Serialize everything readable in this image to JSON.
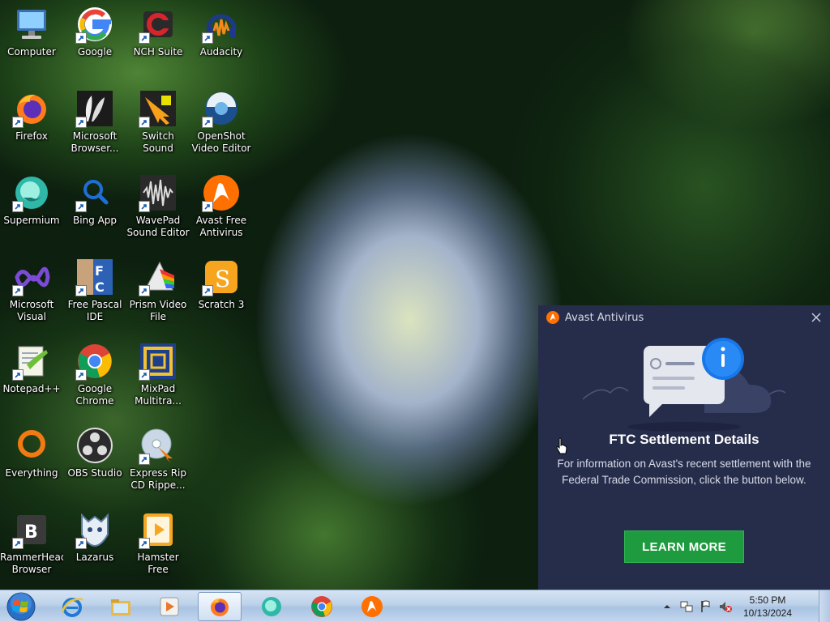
{
  "desktop": {
    "icons": [
      {
        "label": "Computer",
        "icon": "computer-icon"
      },
      {
        "label": "Google",
        "icon": "google-icon"
      },
      {
        "label": "NCH Suite",
        "icon": "nch-suite-icon"
      },
      {
        "label": "Audacity",
        "icon": "audacity-icon"
      },
      {
        "label": "Firefox",
        "icon": "firefox-icon"
      },
      {
        "label": "Microsoft\nBrowser...",
        "icon": "microsoft-browser-icon"
      },
      {
        "label": "Switch Sound\nFile Converter",
        "icon": "switch-sound-icon"
      },
      {
        "label": "OpenShot\nVideo Editor",
        "icon": "openshot-icon"
      },
      {
        "label": "Supermium",
        "icon": "supermium-icon"
      },
      {
        "label": "Bing App",
        "icon": "bing-app-icon"
      },
      {
        "label": "WavePad\nSound Editor",
        "icon": "wavepad-icon"
      },
      {
        "label": "Avast Free\nAntivirus",
        "icon": "avast-icon"
      },
      {
        "label": "Microsoft\nVisual Stud...",
        "icon": "visual-studio-icon"
      },
      {
        "label": "Free Pascal\nIDE",
        "icon": "free-pascal-icon"
      },
      {
        "label": "Prism Video\nFile Converter",
        "icon": "prism-video-icon"
      },
      {
        "label": "Scratch 3",
        "icon": "scratch-icon"
      },
      {
        "label": "Notepad++",
        "icon": "notepadpp-icon"
      },
      {
        "label": "Google\nChrome",
        "icon": "chrome-icon"
      },
      {
        "label": "MixPad\nMultitra...",
        "icon": "mixpad-icon"
      },
      {
        "label": "Everything",
        "icon": "everything-icon"
      },
      {
        "label": "OBS Studio",
        "icon": "obs-studio-icon"
      },
      {
        "label": "Express Rip\nCD Rippe...",
        "icon": "express-rip-icon"
      },
      {
        "label": "RammerHead\nBrowser",
        "icon": "rammerhead-icon"
      },
      {
        "label": "Lazarus",
        "icon": "lazarus-icon"
      },
      {
        "label": "Hamster Free\nVideo Conv...",
        "icon": "hamster-video-icon"
      }
    ]
  },
  "popup": {
    "app_name": "Avast Antivirus",
    "heading": "FTC Settlement Details",
    "body": "For information on Avast's recent settlement with the Federal Trade Commission, click the button below.",
    "button_label": "LEARN MORE",
    "accent": "#1e9b3f",
    "background": "#262d4b"
  },
  "taskbar": {
    "pinned": [
      {
        "icon": "internet-explorer-icon"
      },
      {
        "icon": "file-explorer-icon"
      },
      {
        "icon": "media-player-icon"
      },
      {
        "icon": "firefox-icon",
        "active": true
      },
      {
        "icon": "supermium-icon"
      },
      {
        "icon": "chrome-icon"
      },
      {
        "icon": "avast-icon"
      }
    ],
    "clock": {
      "time": "5:50 PM",
      "date": "10/13/2024"
    }
  }
}
